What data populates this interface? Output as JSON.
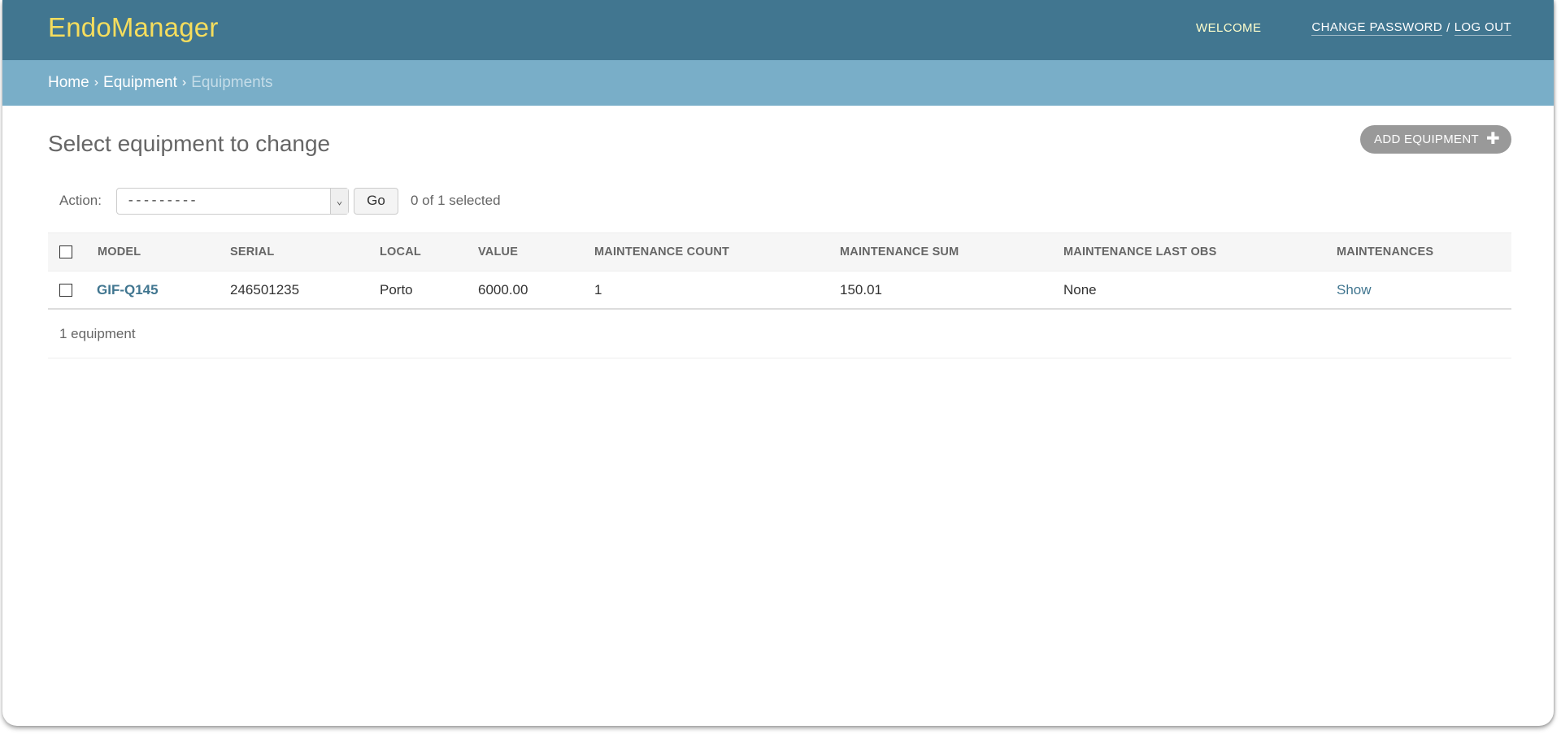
{
  "header": {
    "brand": "EndoManager",
    "welcome": "WELCOME",
    "change_password": "CHANGE PASSWORD",
    "separator": "/",
    "log_out": "LOG OUT"
  },
  "breadcrumbs": {
    "home": "Home",
    "app": "Equipment",
    "current": "Equipments",
    "chevron": "›"
  },
  "page": {
    "title": "Select equipment to change",
    "add_button": "ADD EQUIPMENT",
    "add_icon": "plus-icon"
  },
  "actions": {
    "label": "Action:",
    "selected_value": "---------",
    "go_label": "Go",
    "selection_count": "0 of 1 selected"
  },
  "table": {
    "columns": [
      "MODEL",
      "SERIAL",
      "LOCAL",
      "VALUE",
      "MAINTENANCE COUNT",
      "MAINTENANCE SUM",
      "MAINTENANCE LAST OBS",
      "MAINTENANCES"
    ],
    "rows": [
      {
        "model": "GIF-Q145",
        "serial": "246501235",
        "local": "Porto",
        "value": "6000.00",
        "maintenance_count": "1",
        "maintenance_sum": "150.01",
        "maintenance_last_obs": "None",
        "maintenances": "Show"
      }
    ]
  },
  "paginator": {
    "text": "1 equipment"
  },
  "colors": {
    "header_bg": "#417690",
    "breadcrumb_bg": "#79aec8",
    "brand": "#f5dd5d",
    "link": "#417690"
  }
}
